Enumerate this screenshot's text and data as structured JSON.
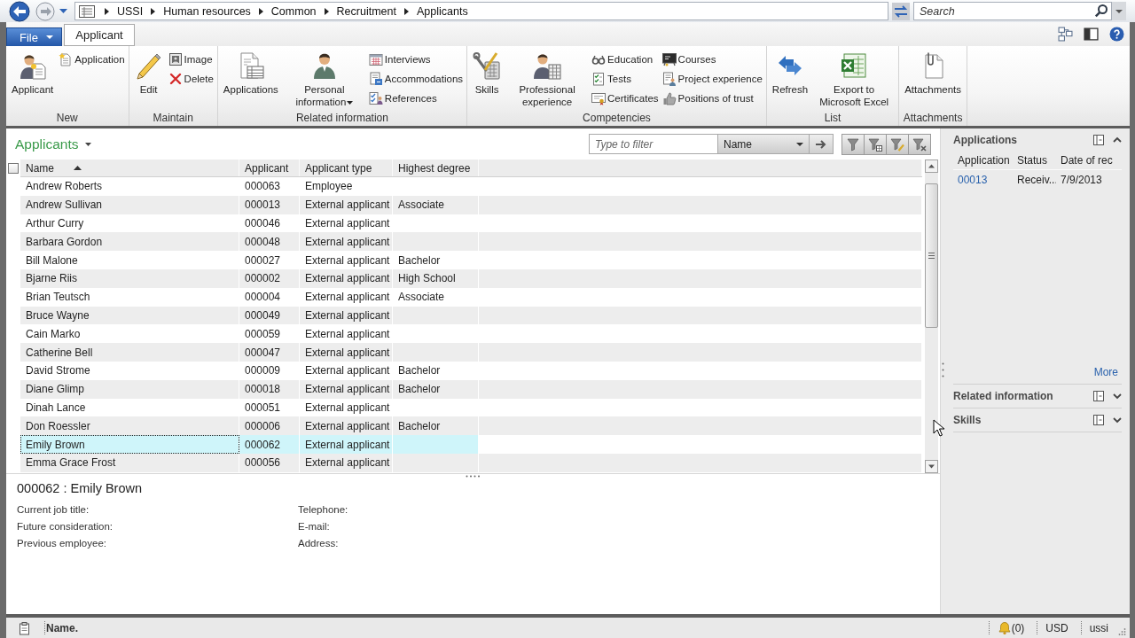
{
  "navigation": {
    "breadcrumb": [
      "USSI",
      "Human resources",
      "Common",
      "Recruitment",
      "Applicants"
    ],
    "search": {
      "placeholder": "Search"
    }
  },
  "ribbon": {
    "tabs": [
      {
        "label": "File",
        "kind": "menu",
        "selected": false
      },
      {
        "label": "Applicant",
        "kind": "tab",
        "selected": true
      }
    ],
    "groups": [
      {
        "label": "New",
        "columns": [
          {
            "kind": "large",
            "label": "Applicant",
            "dropdown": false
          },
          {
            "kind": "small",
            "items": [
              "Application"
            ]
          }
        ]
      },
      {
        "label": "Maintain",
        "columns": [
          {
            "kind": "large",
            "label": "Edit",
            "dropdown": false
          },
          {
            "kind": "small",
            "items": [
              "Image",
              "Delete"
            ]
          }
        ]
      },
      {
        "label": "Related information",
        "columns": [
          {
            "kind": "large",
            "label": "Applications",
            "dropdown": false
          },
          {
            "kind": "large",
            "label": "Personal information",
            "dropdown": true
          },
          {
            "kind": "small",
            "items": [
              "Interviews",
              "Accommodations",
              "References"
            ]
          }
        ]
      },
      {
        "label": "Competencies",
        "columns": [
          {
            "kind": "large",
            "label": "Skills",
            "dropdown": false
          },
          {
            "kind": "large",
            "label": "Professional experience",
            "dropdown": false
          },
          {
            "kind": "small",
            "items": [
              "Education",
              "Tests",
              "Certificates"
            ]
          },
          {
            "kind": "small",
            "items": [
              "Courses",
              "Project experience",
              "Positions of trust"
            ]
          }
        ]
      },
      {
        "label": "List",
        "columns": [
          {
            "kind": "large",
            "label": "Refresh",
            "dropdown": false
          },
          {
            "kind": "large",
            "label": "Export to Microsoft Excel",
            "dropdown": false
          }
        ]
      },
      {
        "label": "Attachments",
        "columns": [
          {
            "kind": "large",
            "label": "Attachments",
            "dropdown": false
          }
        ]
      }
    ]
  },
  "list": {
    "title": "Applicants",
    "filter": {
      "placeholder": "Type to filter",
      "column": "Name"
    }
  },
  "table": {
    "select_all": {
      "checked": false
    },
    "columns": [
      {
        "label": "Name",
        "sorted": true
      },
      {
        "label": "Applicant",
        "sorted": false
      },
      {
        "label": "Applicant type",
        "sorted": false
      },
      {
        "label": "Highest degree",
        "sorted": false
      }
    ],
    "rows": [
      {
        "name": "Andrew Roberts",
        "applicant": "000063",
        "applicant_type": "Employee",
        "selected": false
      },
      {
        "name": "Andrew Sullivan",
        "applicant": "000013",
        "applicant_type": "External applicant",
        "highest_degree": "Associate",
        "selected": false
      },
      {
        "name": "Arthur Curry",
        "applicant": "000046",
        "applicant_type": "External applicant",
        "selected": false
      },
      {
        "name": "Barbara Gordon",
        "applicant": "000048",
        "applicant_type": "External applicant",
        "selected": false
      },
      {
        "name": "Bill Malone",
        "applicant": "000027",
        "applicant_type": "External applicant",
        "highest_degree": "Bachelor",
        "selected": false
      },
      {
        "name": "Bjarne Riis",
        "applicant": "000002",
        "applicant_type": "External applicant",
        "highest_degree": "High School",
        "selected": false
      },
      {
        "name": "Brian Teutsch",
        "applicant": "000004",
        "applicant_type": "External applicant",
        "highest_degree": "Associate",
        "selected": false
      },
      {
        "name": "Bruce Wayne",
        "applicant": "000049",
        "applicant_type": "External applicant",
        "selected": false
      },
      {
        "name": "Cain Marko",
        "applicant": "000059",
        "applicant_type": "External applicant",
        "selected": false
      },
      {
        "name": "Catherine Bell",
        "applicant": "000047",
        "applicant_type": "External applicant",
        "selected": false
      },
      {
        "name": "David Strome",
        "applicant": "000009",
        "applicant_type": "External applicant",
        "highest_degree": "Bachelor",
        "selected": false
      },
      {
        "name": "Diane Glimp",
        "applicant": "000018",
        "applicant_type": "External applicant",
        "highest_degree": "Bachelor",
        "selected": false
      },
      {
        "name": "Dinah Lance",
        "applicant": "000051",
        "applicant_type": "External applicant",
        "selected": false
      },
      {
        "name": "Don Roessler",
        "applicant": "000006",
        "applicant_type": "External applicant",
        "highest_degree": "Bachelor",
        "selected": false
      },
      {
        "name": "Emily Brown",
        "applicant": "000062",
        "applicant_type": "External applicant",
        "selected": true
      },
      {
        "name": "Emma Grace Frost",
        "applicant": "000056",
        "applicant_type": "External applicant",
        "selected": false
      }
    ]
  },
  "details": {
    "title": "000062 : Emily Brown",
    "fields": [
      [
        "Current job title:",
        "Future consideration:",
        "Previous employee:"
      ],
      [
        "Telephone:",
        "E-mail:",
        "Address:"
      ]
    ]
  },
  "factbox": {
    "panes": [
      {
        "title": "Applications",
        "expanded": true,
        "columns": [
          "Application",
          "Status",
          "Date of rec"
        ],
        "rows": [
          [
            "00013",
            "Receiv...",
            "7/9/2013"
          ]
        ],
        "link": "More"
      },
      {
        "title": "Related information",
        "expanded": false
      },
      {
        "title": "Skills",
        "expanded": false
      }
    ]
  },
  "status_bar": {
    "text": "Name.",
    "notifications": "(0)",
    "currency": "USD",
    "user": "ussi"
  }
}
